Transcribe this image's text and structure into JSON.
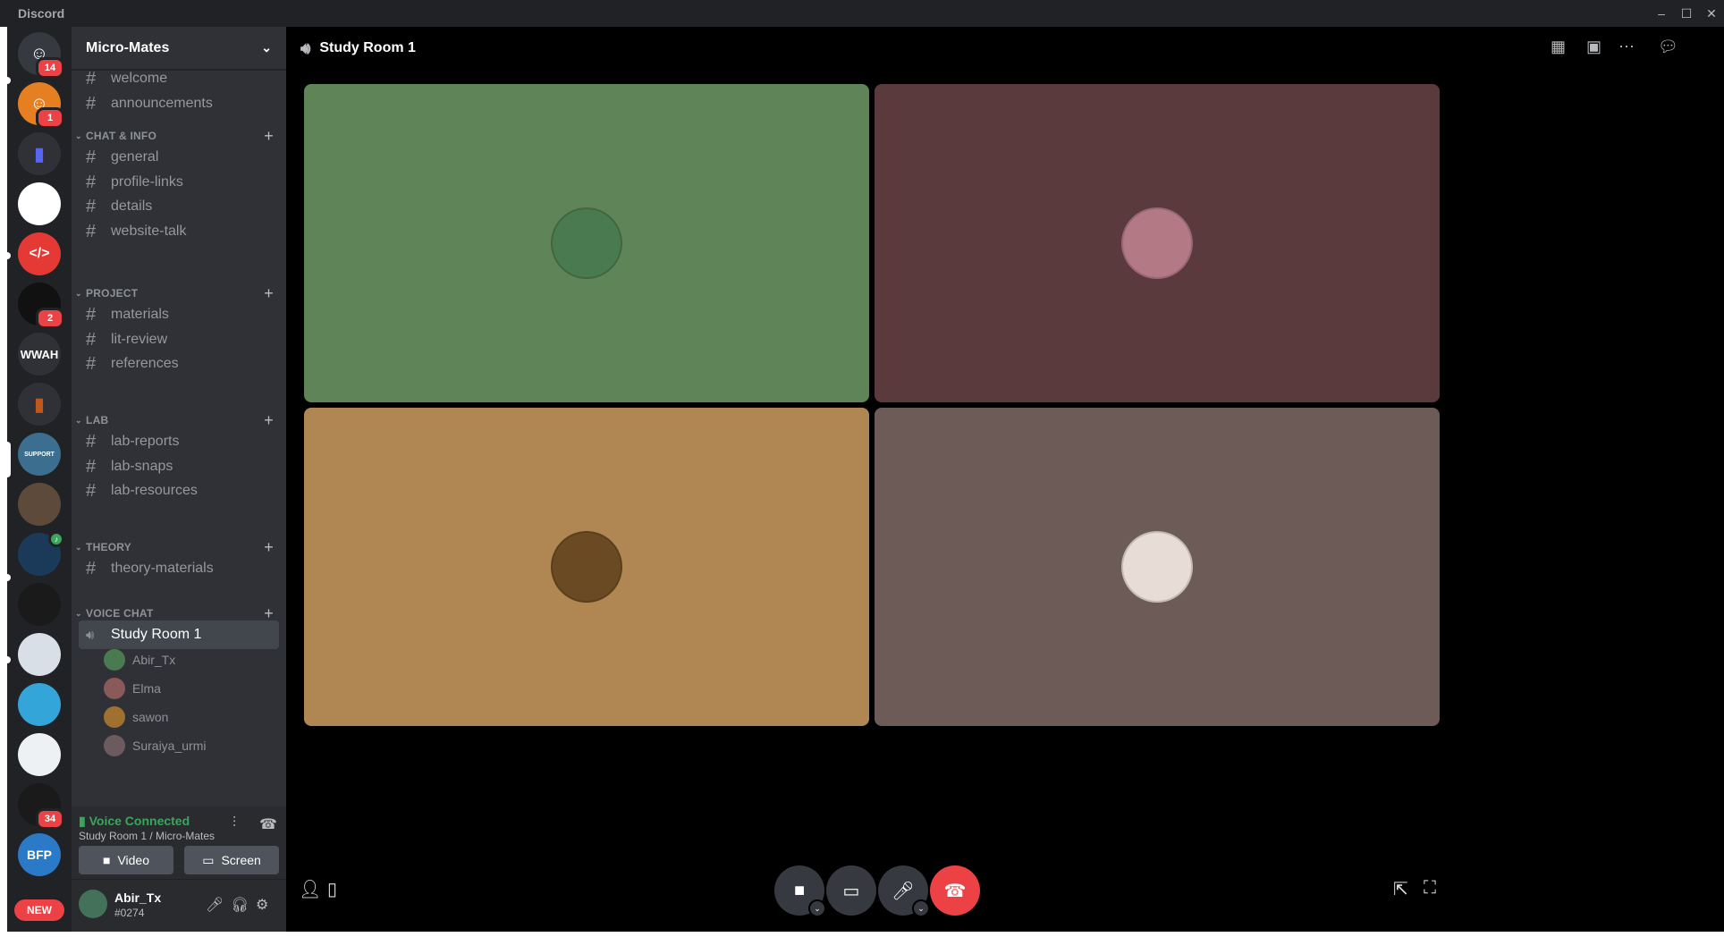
{
  "window": {
    "app_name": "Discord",
    "controls": [
      "–",
      "☐",
      "✕"
    ]
  },
  "servers": [
    {
      "name": "home",
      "label": "",
      "color": "#36393f",
      "badge": "14",
      "glyph": "☺"
    },
    {
      "name": "friends",
      "label": "",
      "color": "#e67e22",
      "badge": "1",
      "glyph": "☺"
    },
    {
      "name": "folder-blue",
      "label": "",
      "color": "#2f3136",
      "badge": "",
      "glyph": "▬"
    },
    {
      "name": "aiubpc",
      "label": "",
      "color": "#ffffff",
      "badge": "",
      "glyph": ""
    },
    {
      "name": "code",
      "label": "",
      "color": "#e53935",
      "badge": "",
      "glyph": "</>"
    },
    {
      "name": "venom",
      "label": "",
      "color": "#111111",
      "badge": "2",
      "glyph": ""
    },
    {
      "name": "wwah",
      "label": "WWAH",
      "color": "#2f3136",
      "badge": "",
      "glyph": ""
    },
    {
      "name": "folder-orange",
      "label": "",
      "color": "#2f3136",
      "badge": "",
      "glyph": "▬"
    },
    {
      "name": "support",
      "label": "SUPPORT",
      "color": "#3b6e8f",
      "badge": "",
      "glyph": ""
    },
    {
      "name": "photo-server",
      "label": "",
      "color": "#5d4a3a",
      "badge": "",
      "glyph": ""
    },
    {
      "name": "game-server",
      "label": "",
      "color": "#1b3a5a",
      "badge": "",
      "glyph": ""
    },
    {
      "name": "red-logo",
      "label": "",
      "color": "#1a1a1a",
      "badge": "",
      "glyph": ""
    },
    {
      "name": "map-server",
      "label": "",
      "color": "#d8dfe6",
      "badge": "",
      "glyph": ""
    },
    {
      "name": "cartoon",
      "label": "",
      "color": "#34a5d8",
      "badge": "",
      "glyph": ""
    },
    {
      "name": "pattern",
      "label": "",
      "color": "#eef1f4",
      "badge": "",
      "glyph": ""
    },
    {
      "name": "red-team",
      "label": "",
      "color": "#1a1a1a",
      "badge": "34",
      "glyph": ""
    },
    {
      "name": "bfp",
      "label": "BFP",
      "color": "#2a7ac7",
      "badge": "",
      "glyph": ""
    }
  ],
  "rail_new": "NEW",
  "guild": {
    "name": "Micro-Mates",
    "top_channels": [
      "welcome",
      "announcements"
    ],
    "categories": [
      {
        "name": "CHAT & INFO",
        "channels": [
          "general",
          "profile-links",
          "details",
          "website-talk"
        ]
      },
      {
        "name": "PROJECT",
        "channels": [
          "materials",
          "lit-review",
          "references"
        ]
      },
      {
        "name": "LAB",
        "channels": [
          "lab-reports",
          "lab-snaps",
          "lab-resources"
        ]
      },
      {
        "name": "THEORY",
        "channels": [
          "theory-materials"
        ]
      },
      {
        "name": "VOICE CHAT",
        "channels": []
      }
    ],
    "voice_channel": "Study Room 1",
    "voice_users": [
      {
        "name": "Abir_Tx",
        "color": "#4a7a4f"
      },
      {
        "name": "Elma",
        "color": "#8a5a5a"
      },
      {
        "name": "sawon",
        "color": "#a07030"
      },
      {
        "name": "Suraiya_urmi",
        "color": "#6b5b5e"
      }
    ]
  },
  "voice_panel": {
    "status": "Voice Connected",
    "location": "Study Room 1 / Micro-Mates",
    "video_label": "Video",
    "screen_label": "Screen"
  },
  "user": {
    "name": "Abir_Tx",
    "tag": "#0274"
  },
  "stage": {
    "title": "Study Room 1",
    "tiles": [
      {
        "user": "Abir_Tx",
        "bg": "#5f8458",
        "avatar_color": "#4a7a4f"
      },
      {
        "user": "Elma",
        "bg": "#5a3a3d",
        "avatar_color": "#b37a86"
      },
      {
        "user": "sawon",
        "bg": "#b08652",
        "avatar_color": "#6a4a22"
      },
      {
        "user": "Suraiya_urmi",
        "bg": "#6d5b58",
        "avatar_color": "#e7dcd6"
      }
    ]
  },
  "colors": {
    "accent": "#5865f2",
    "danger": "#ed4245",
    "online": "#3ba55d"
  }
}
